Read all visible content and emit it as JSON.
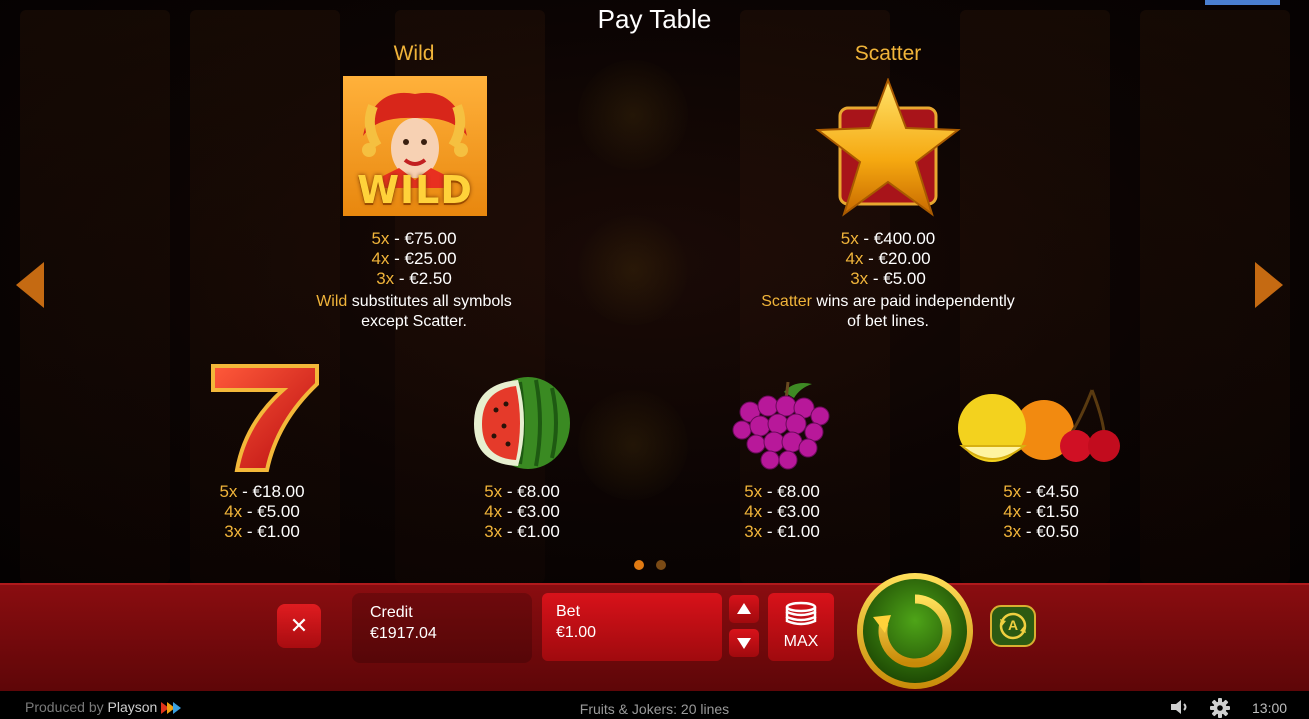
{
  "title": "Pay Table",
  "wild": {
    "heading": "Wild",
    "icon": "jester-wild-icon",
    "icon_text": "WILD",
    "pays": [
      {
        "mult": "5x",
        "amount": " - €75.00"
      },
      {
        "mult": "4x",
        "amount": " - €25.00"
      },
      {
        "mult": "3x",
        "amount": " - €2.50"
      }
    ],
    "note_highlight": "Wild",
    "note_line1": " substitutes all symbols",
    "note_line2": "except Scatter."
  },
  "scatter": {
    "heading": "Scatter",
    "icon": "star-scatter-icon",
    "pays": [
      {
        "mult": "5x",
        "amount": " - €400.00"
      },
      {
        "mult": "4x",
        "amount": " - €20.00"
      },
      {
        "mult": "3x",
        "amount": " - €5.00"
      }
    ],
    "note_highlight": "Scatter",
    "note_line1": " wins are paid independently",
    "note_line2": "of bet lines."
  },
  "symbols": [
    {
      "icon": "seven-icon",
      "pays": [
        {
          "mult": "5x",
          "amount": " - €18.00"
        },
        {
          "mult": "4x",
          "amount": " - €5.00"
        },
        {
          "mult": "3x",
          "amount": " - €1.00"
        }
      ]
    },
    {
      "icon": "watermelon-icon",
      "pays": [
        {
          "mult": "5x",
          "amount": " - €8.00"
        },
        {
          "mult": "4x",
          "amount": " - €3.00"
        },
        {
          "mult": "3x",
          "amount": " - €1.00"
        }
      ]
    },
    {
      "icon": "grapes-icon",
      "pays": [
        {
          "mult": "5x",
          "amount": " - €8.00"
        },
        {
          "mult": "4x",
          "amount": " - €3.00"
        },
        {
          "mult": "3x",
          "amount": " - €1.00"
        }
      ]
    },
    {
      "icon": "lemon-orange-cherry-icon",
      "pays": [
        {
          "mult": "5x",
          "amount": " - €4.50"
        },
        {
          "mult": "4x",
          "amount": " - €1.50"
        },
        {
          "mult": "3x",
          "amount": " - €0.50"
        }
      ]
    }
  ],
  "pagination": {
    "pages": 2,
    "current": 1
  },
  "controls": {
    "credit_label": "Credit",
    "credit_value": "€1917.04",
    "bet_label": "Bet",
    "bet_value": "€1.00",
    "max_label": "MAX",
    "close_symbol": "✕",
    "auto_letter": "A"
  },
  "footer": {
    "produced_by": "Produced by ",
    "brand": "Playson",
    "game_name": "Fruits & Jokers: 20 lines",
    "time": "13:00"
  },
  "colors": {
    "accent_gold": "#f0b43a",
    "panel_red": "#8a0d10",
    "arrow_orange": "#c56a12",
    "spin_green": "#2e6a06"
  }
}
